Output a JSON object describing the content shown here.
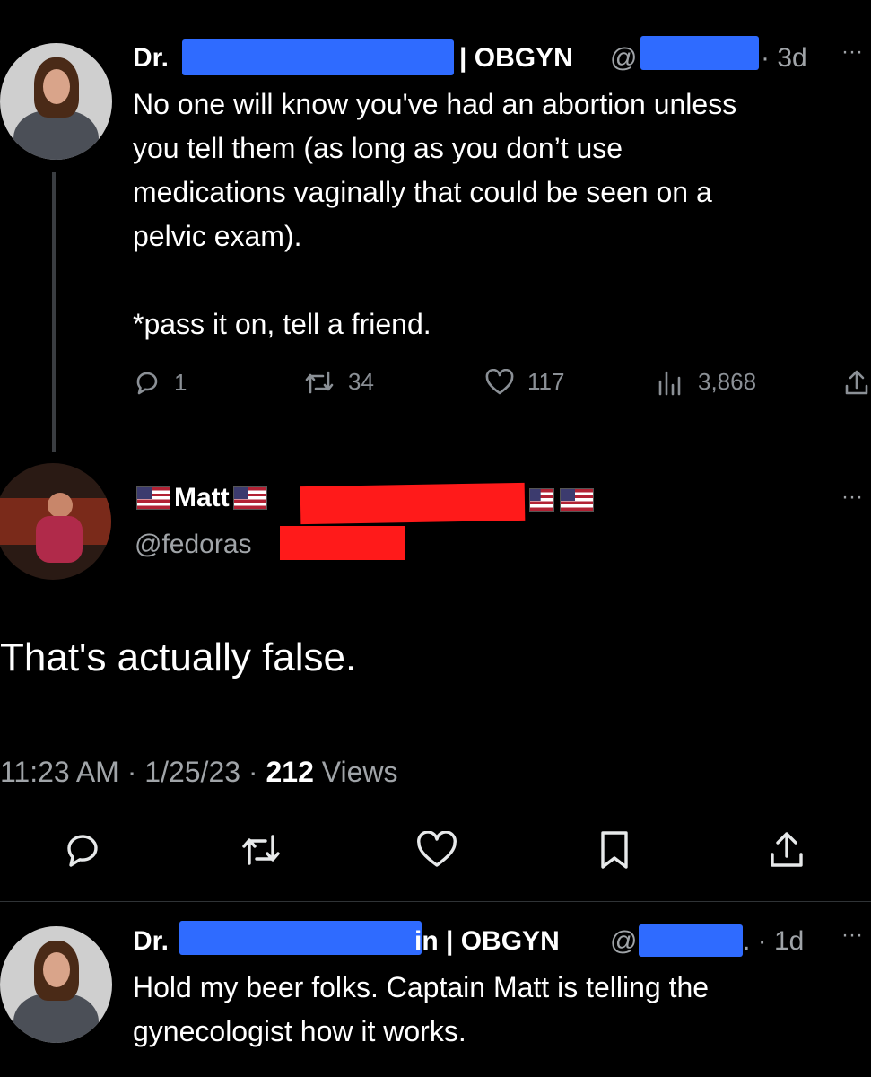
{
  "tweet1": {
    "name_prefix": "Dr.",
    "name_suffix": "| OBGYN",
    "handle_prefix": "@",
    "time": "· 3d",
    "more": "···",
    "body_lines": [
      "No one will know you've had an abortion unless",
      "you tell them (as long as you don’t use",
      "medications vaginally that could be seen on a",
      "pelvic exam).",
      "",
      "*pass it on, tell a friend."
    ],
    "stats": {
      "replies": "1",
      "retweets": "34",
      "likes": "117",
      "views": "3,868"
    }
  },
  "reply": {
    "name": "Matt",
    "handle_prefix": "@fedoras",
    "more": "···",
    "body": "That's actually false.",
    "meta_time": "11:23 AM · 1/25/23 ·",
    "meta_views_count": "212",
    "meta_views_label": "Views"
  },
  "tweet3": {
    "name_prefix": "Dr.",
    "name_suffix": "in | OBGYN",
    "handle_prefix": "@",
    "time": ". · 1d",
    "more": "···",
    "body_lines": [
      "Hold my beer folks. Captain Matt is telling the",
      "gynecologist how it works."
    ]
  },
  "colors": {
    "redact_blue": "#2f6bff",
    "redact_red": "#ff1a1a",
    "background": "#000000"
  }
}
